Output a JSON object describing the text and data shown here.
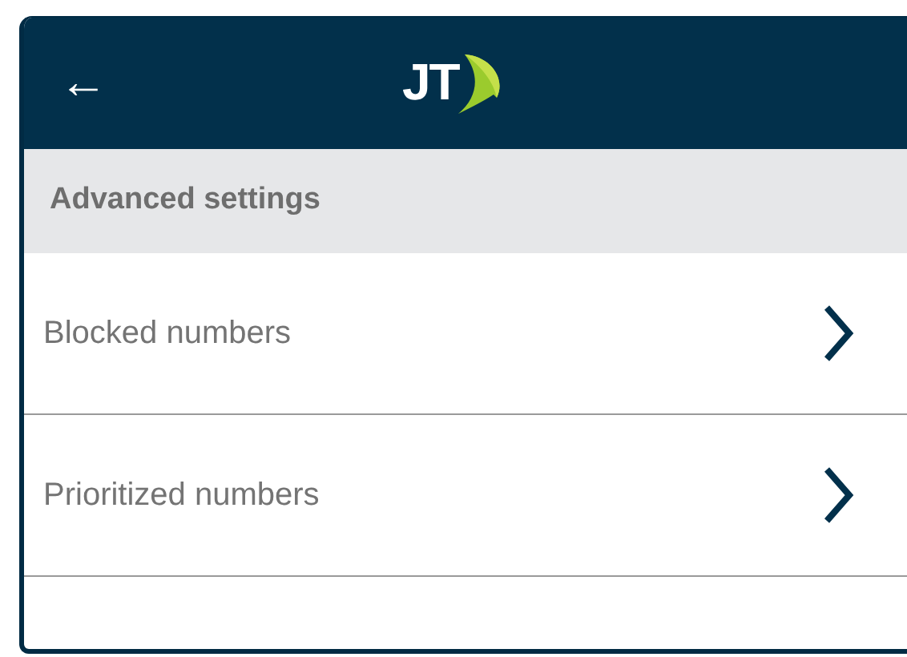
{
  "header": {
    "back": "←",
    "logo": "JT"
  },
  "section": {
    "title": "Advanced settings"
  },
  "items": [
    {
      "label": "Blocked numbers"
    },
    {
      "label": "Prioritized numbers"
    }
  ]
}
